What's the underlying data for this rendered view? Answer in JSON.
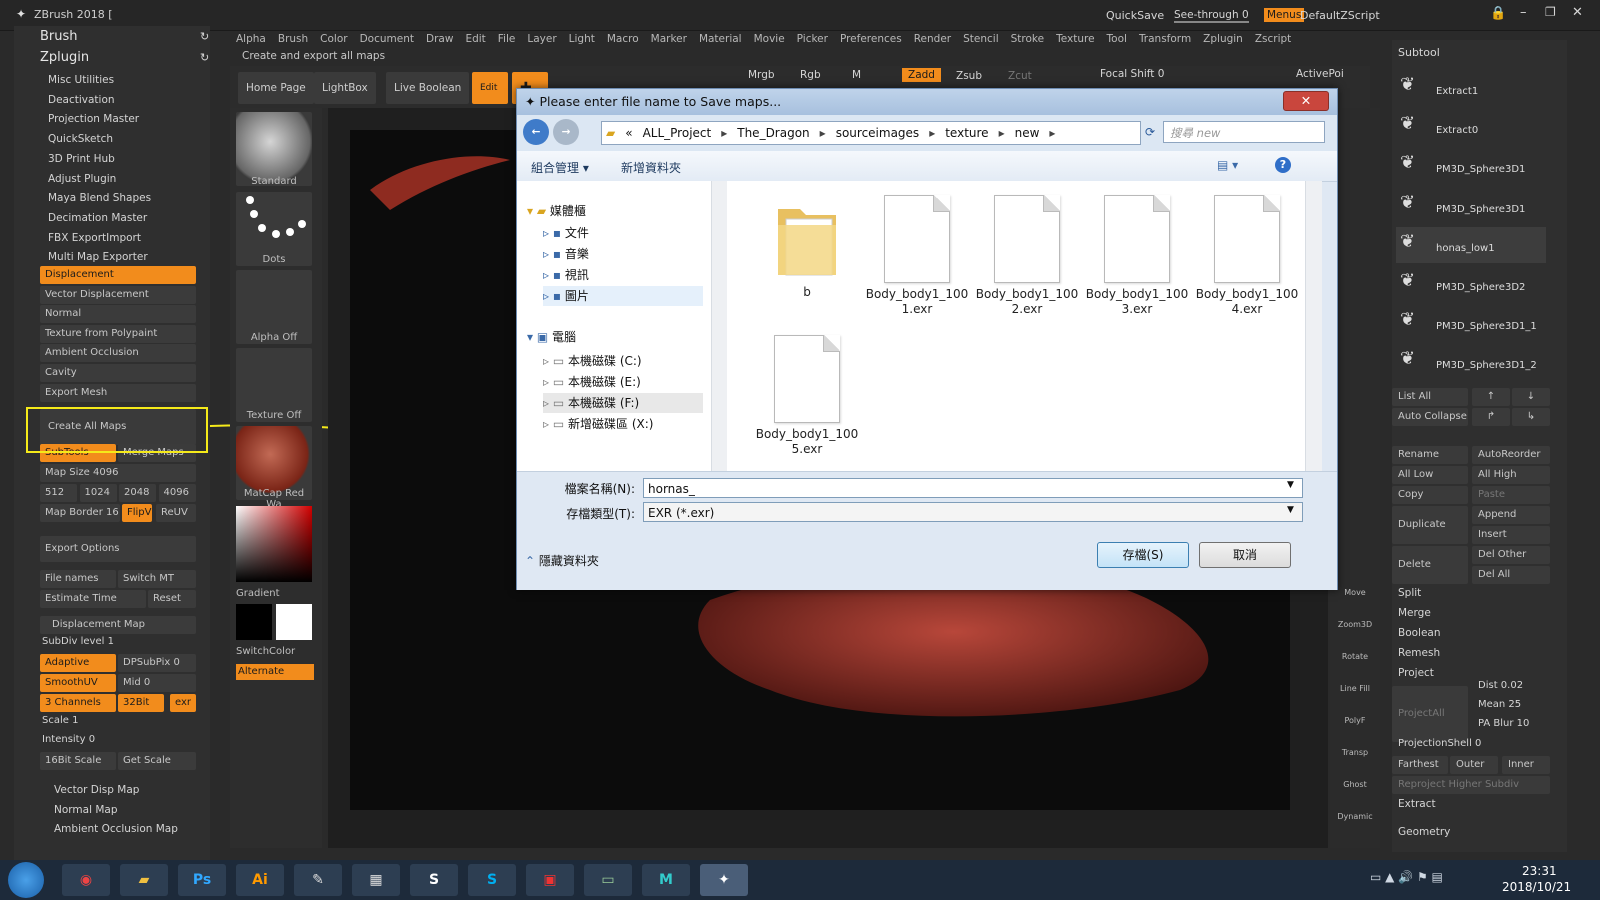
{
  "app": {
    "title": "ZBrush 2018 [",
    "quicksave": "QuickSave",
    "see_through": "See-through  0",
    "menus": "Menus",
    "script": "DefaultZScript"
  },
  "menus": [
    "Alpha",
    "Brush",
    "Color",
    "Document",
    "Draw",
    "Edit",
    "File",
    "Layer",
    "Light",
    "Macro",
    "Marker",
    "Material",
    "Movie",
    "Picker",
    "Preferences",
    "Render",
    "Stencil",
    "Stroke",
    "Texture",
    "Tool",
    "Transform",
    "Zplugin",
    "Zscript"
  ],
  "status_hint": "Create and export all maps",
  "left": {
    "brush": "Brush",
    "zplugin": "Zplugin",
    "plugins": [
      "Misc Utilities",
      "Deactivation",
      "Projection Master",
      "QuickSketch",
      "3D Print Hub",
      "Adjust Plugin",
      "Maya Blend Shapes",
      "Decimation Master",
      "FBX ExportImport",
      "Multi Map Exporter"
    ],
    "mme_items": [
      "Displacement",
      "Vector Displacement",
      "Normal",
      "Texture from Polypaint",
      "Ambient Occlusion",
      "Cavity",
      "Export Mesh"
    ],
    "create_all_maps": "Create All Maps",
    "subtools": "SubTools",
    "merge_maps": "Merge Maps",
    "map_size": "Map Size 4096",
    "sizes": [
      "512",
      "1024",
      "2048",
      "4096"
    ],
    "map_border": "Map Border 16",
    "flipv": "FlipV",
    "reuv": "ReUV",
    "export_options": "Export Options",
    "file_names": "File names",
    "switch_mt": "Switch MT",
    "estimate_time": "Estimate Time",
    "reset": "Reset",
    "disp_map": "Displacement Map",
    "subdiv": "SubDiv level 1",
    "adaptive": "Adaptive",
    "dpsubpix": "DPSubPix 0",
    "smoothuv": "SmoothUV",
    "mid": "Mid 0",
    "channels": "3 Channels",
    "bit": "32Bit",
    "exr": "exr",
    "scale": "Scale 1",
    "intensity": "Intensity 0",
    "bitscale": "16Bit Scale",
    "get_scale": "Get Scale",
    "vector_disp": "Vector Disp Map",
    "normal_map": "Normal Map",
    "ao_map": "Ambient Occlusion Map"
  },
  "toolbar": {
    "home": "Home Page",
    "lightbox": "LightBox",
    "live_boolean": "Live Boolean",
    "edit": "Edit",
    "mrgb": "Mrgb",
    "rgb": "Rgb",
    "m": "M",
    "zadd": "Zadd",
    "zsub": "Zsub",
    "zcut": "Zcut",
    "focal": "Focal Shift 0",
    "activepoints": "ActivePoi"
  },
  "mid": {
    "standard": "Standard",
    "dots": "Dots",
    "alpha_off": "Alpha Off",
    "texture_off": "Texture Off",
    "matcap": "MatCap Red Wa",
    "gradient": "Gradient",
    "switchcolor": "SwitchColor",
    "alternate": "Alternate"
  },
  "right_strip": [
    "Move",
    "Zoom3D",
    "Rotate",
    "Line Fill",
    "PolyF",
    "Transp",
    "Ghost",
    "Dynamic"
  ],
  "right": {
    "subtool": "Subtool",
    "subtools": [
      "Extract1",
      "Extract0",
      "PM3D_Sphere3D1",
      "PM3D_Sphere3D1",
      "honas_low1",
      "PM3D_Sphere3D2",
      "PM3D_Sphere3D1_1",
      "PM3D_Sphere3D1_2"
    ],
    "list_all": "List All",
    "auto_collapse": "Auto Collapse",
    "rename": "Rename",
    "autoreorder": "AutoReorder",
    "all_low": "All Low",
    "all_high": "All High",
    "copy": "Copy",
    "paste": "Paste",
    "duplicate": "Duplicate",
    "append": "Append",
    "insert": "Insert",
    "delete": "Delete",
    "del_other": "Del Other",
    "del_all": "Del All",
    "split": "Split",
    "merge": "Merge",
    "boolean": "Boolean",
    "remesh": "Remesh",
    "project": "Project",
    "project_all": "ProjectAll",
    "dist": "Dist 0.02",
    "mean": "Mean 25",
    "pa_blur": "PA Blur 10",
    "projection_shell": "ProjectionShell 0",
    "farthest": "Farthest",
    "outer": "Outer",
    "inner": "Inner",
    "reproject": "Reproject Higher Subdiv",
    "extract": "Extract",
    "geometry": "Geometry"
  },
  "dialog": {
    "title": "Please enter file name to Save maps...",
    "path": [
      "«",
      "ALL_Project",
      "The_Dragon",
      "sourceimages",
      "texture",
      "new"
    ],
    "search": "搜尋 new",
    "organize": "組合管理 ▾",
    "new_folder": "新增資料夾",
    "nav": {
      "libraries": "媒體櫃",
      "lib_items": [
        "文件",
        "音樂",
        "視訊",
        "圖片"
      ],
      "computer": "電腦",
      "drives": [
        "本機磁碟 (C:)",
        "本機磁碟 (E:)",
        "本機磁碟 (F:)",
        "新增磁碟區 (X:)"
      ]
    },
    "files": [
      {
        "name": "b",
        "kind": "folder"
      },
      {
        "name": "Body_body1_1001.exr",
        "kind": "file"
      },
      {
        "name": "Body_body1_1002.exr",
        "kind": "file"
      },
      {
        "name": "Body_body1_1003.exr",
        "kind": "file"
      },
      {
        "name": "Body_body1_1004.exr",
        "kind": "file"
      },
      {
        "name": "Body_body1_1005.exr",
        "kind": "file"
      }
    ],
    "filename_label": "檔案名稱(N):",
    "filename_value": "hornas_",
    "filetype_label": "存檔類型(T):",
    "filetype_value": "EXR (*.exr)",
    "hide_folders": "隱藏資料夾",
    "save": "存檔(S)",
    "cancel": "取消"
  },
  "taskbar": {
    "time": "23:31",
    "date": "2018/10/21"
  },
  "colors": {
    "accent": "#f28c1c",
    "highlight": "#f5ea1a"
  }
}
